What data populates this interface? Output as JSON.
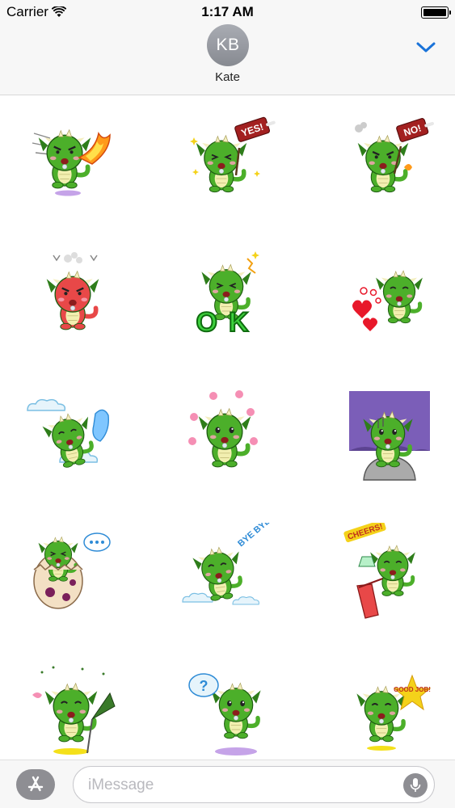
{
  "status_bar": {
    "carrier": "Carrier",
    "time": "1:17 AM",
    "battery_level": 1.0
  },
  "header": {
    "avatar_initials": "KB",
    "contact_name": "Kate",
    "collapse_icon": "chevron-down-icon"
  },
  "stickers": [
    {
      "name": "dragon-fire-breath",
      "caption": ""
    },
    {
      "name": "dragon-yes-sign",
      "caption": "YES!"
    },
    {
      "name": "dragon-no-sign",
      "caption": "NO!"
    },
    {
      "name": "dragon-angry-red",
      "caption": ""
    },
    {
      "name": "dragon-ok",
      "caption": "OK"
    },
    {
      "name": "dragon-hearts",
      "caption": ""
    },
    {
      "name": "dragon-sleeping-ghost",
      "caption": ""
    },
    {
      "name": "dragon-crying-flowers",
      "caption": ""
    },
    {
      "name": "dragon-shocked-rock",
      "caption": ""
    },
    {
      "name": "dragon-egg-hatching",
      "caption": ""
    },
    {
      "name": "dragon-bye-bye",
      "caption": "BYE BYE!"
    },
    {
      "name": "dragon-cheers",
      "caption": "CHEERS!"
    },
    {
      "name": "dragon-cheering-flag",
      "caption": ""
    },
    {
      "name": "dragon-question",
      "caption": "?"
    },
    {
      "name": "dragon-good-job",
      "caption": "GOOD JOB!"
    }
  ],
  "composer": {
    "placeholder": "iMessage",
    "app_store_icon": "app-store-icon",
    "mic_icon": "microphone-icon"
  },
  "colors": {
    "accent": "#1a73d9",
    "dragon_green": "#4caf2a",
    "dragon_dark": "#2e7d1a",
    "belly": "#f2efb0"
  }
}
